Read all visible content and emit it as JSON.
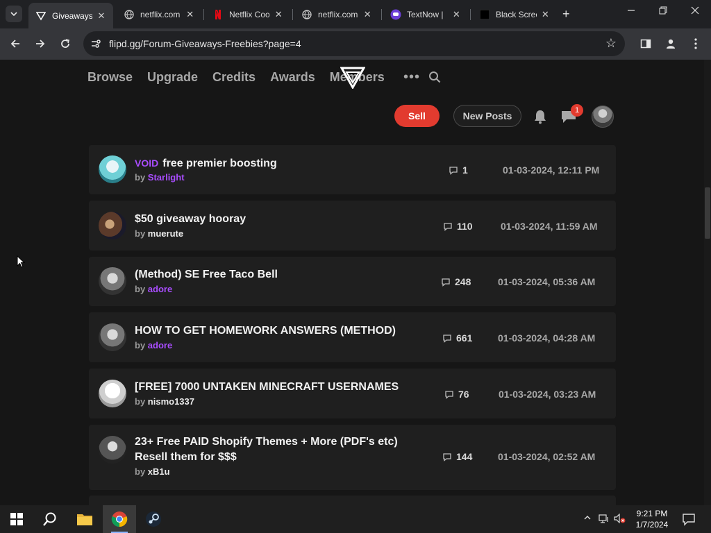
{
  "browser": {
    "tabs": [
      {
        "title": "Giveaways",
        "favicon": "flipd-logo-icon",
        "active": true
      },
      {
        "title": "netflix.com",
        "favicon": "globe-icon",
        "active": false
      },
      {
        "title": "Netflix Coo",
        "favicon": "netflix-logo-icon",
        "active": false
      },
      {
        "title": "netflix.com",
        "favicon": "globe-icon",
        "active": false
      },
      {
        "title": "TextNow |",
        "favicon": "textnow-logo-icon",
        "active": false
      },
      {
        "title": "Black Scree",
        "favicon": "black-square-icon",
        "active": false
      }
    ],
    "url": "flipd.gg/Forum-Giveaways-Freebies?page=4"
  },
  "site": {
    "nav": [
      "Browse",
      "Upgrade",
      "Credits",
      "Awards",
      "Members"
    ],
    "more": "•••",
    "sell_label": "Sell",
    "newposts_label": "New Posts",
    "notif_count": "1",
    "by_prefix": "by"
  },
  "threads": [
    {
      "tag": "VOID",
      "title": "free premier boosting",
      "title2": "",
      "author": "Starlight",
      "author_style": "purple",
      "replies": "1",
      "date": "01-03-2024, 12:11 PM"
    },
    {
      "tag": "",
      "title": "$50 giveaway hooray",
      "title2": "",
      "author": "muerute",
      "author_style": "white",
      "replies": "110",
      "date": "01-03-2024, 11:59 AM"
    },
    {
      "tag": "",
      "title": "(Method) SE Free Taco Bell",
      "title2": "",
      "author": "adore",
      "author_style": "purple",
      "replies": "248",
      "date": "01-03-2024, 05:36 AM"
    },
    {
      "tag": "",
      "title": "HOW TO GET HOMEWORK ANSWERS (METHOD)",
      "title2": "",
      "author": "adore",
      "author_style": "purple",
      "replies": "661",
      "date": "01-03-2024, 04:28 AM"
    },
    {
      "tag": "",
      "title": "[FREE] 7000 UNTAKEN MINECRAFT USERNAMES",
      "title2": "",
      "author": "nismo1337",
      "author_style": "white",
      "replies": "76",
      "date": "01-03-2024, 03:23 AM"
    },
    {
      "tag": "",
      "title": "23+ Free PAID Shopify Themes + More (PDF's etc)",
      "title2": "Resell them for $$$",
      "author": "xB1u",
      "author_style": "white",
      "replies": "144",
      "date": "01-03-2024, 02:52 AM"
    }
  ],
  "taskbar": {
    "time": "9:21 PM",
    "date": "1/7/2024"
  },
  "colors": {
    "accent_red": "#e23b2f",
    "purple": "#a94dff"
  }
}
